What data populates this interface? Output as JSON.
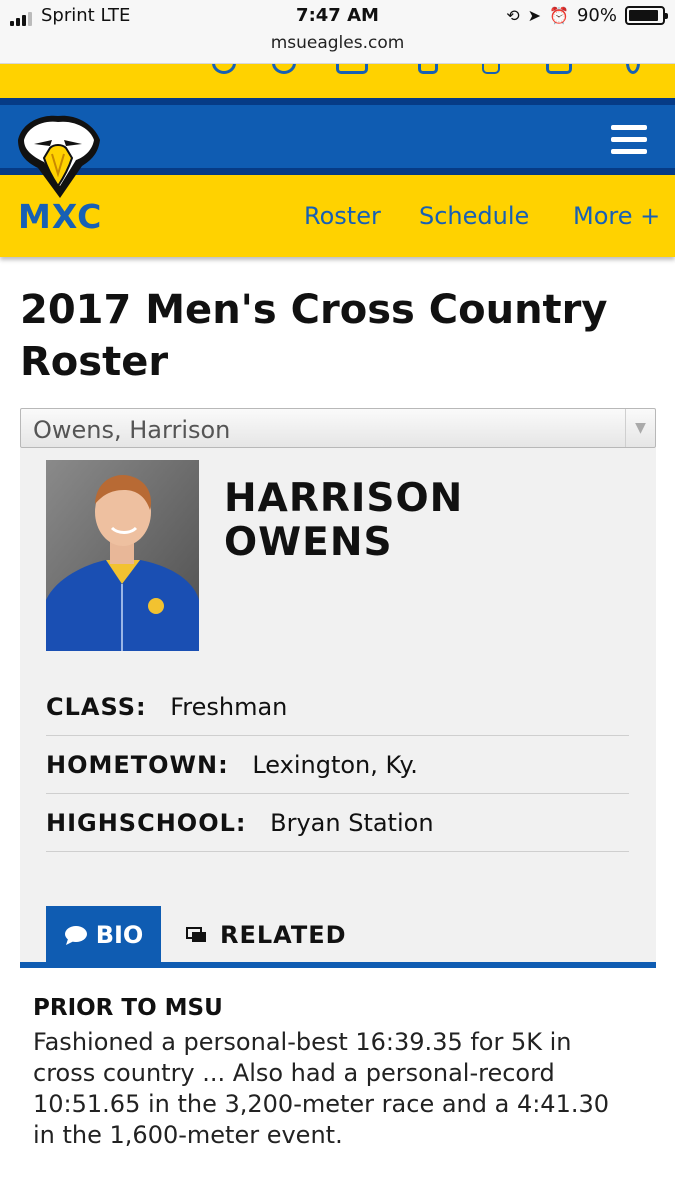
{
  "status_bar": {
    "carrier": "Sprint  LTE",
    "time": "7:47 AM",
    "url": "msueagles.com",
    "battery": "90%",
    "battery_level": 0.9,
    "icons": [
      "signal-icon",
      "rotation-lock-icon",
      "location-icon",
      "alarm-icon",
      "battery-icon"
    ]
  },
  "header": {
    "logo_icon": "eagle-logo-icon",
    "menu_icon": "hamburger-menu-icon",
    "sport": "MXC",
    "nav": [
      "Roster",
      "Schedule",
      "More +"
    ]
  },
  "page": {
    "title": "2017 Men's Cross Country Roster"
  },
  "roster_select": {
    "value": "Owens, Harrison"
  },
  "player": {
    "name": "HARRISON OWENS",
    "details": [
      {
        "label": "CLASS:",
        "value": "Freshman"
      },
      {
        "label": "HOMETOWN:",
        "value": "Lexington, Ky."
      },
      {
        "label": "HIGHSCHOOL:",
        "value": "Bryan Station"
      }
    ]
  },
  "tabs": [
    {
      "label": "BIO",
      "icon": "speech-bubble-icon",
      "active": true
    },
    {
      "label": "RELATED",
      "icon": "gallery-icon",
      "active": false
    }
  ],
  "bio": {
    "heading": "PRIOR TO MSU",
    "text": "Fashioned a personal-best 16:39.35 for 5K in cross country ... Also had a personal-record 10:51.65 in the 3,200-meter race and a 4:41.30 in the 1,600-meter event."
  },
  "colors": {
    "brand_blue": "#0f5cb2",
    "dark_blue": "#063b86",
    "brand_yellow": "#ffd200"
  }
}
